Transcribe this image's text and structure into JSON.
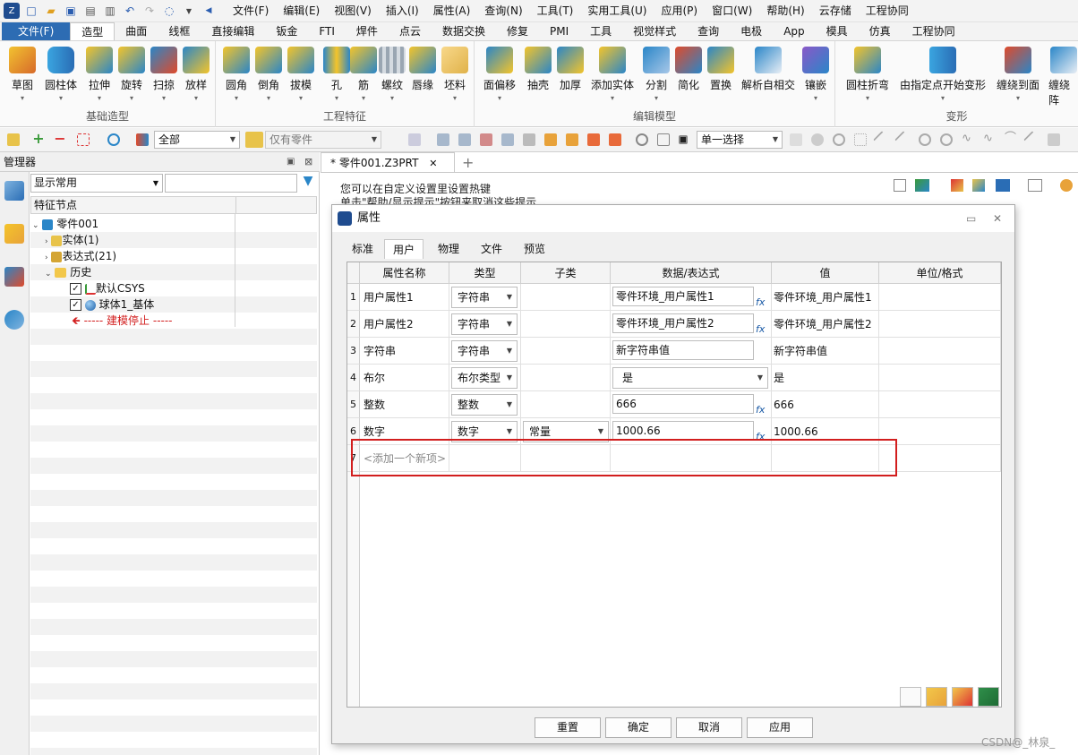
{
  "titlebar": {
    "menus": [
      "文件(F)",
      "编辑(E)",
      "视图(V)",
      "插入(I)",
      "属性(A)",
      "查询(N)",
      "工具(T)",
      "实用工具(U)",
      "应用(P)",
      "窗口(W)",
      "帮助(H)",
      "云存储",
      "工程协同"
    ]
  },
  "ribbon_tabs": [
    "文件(F)",
    "造型",
    "曲面",
    "线框",
    "直接编辑",
    "钣金",
    "FTI",
    "焊件",
    "点云",
    "数据交换",
    "修复",
    "PMI",
    "工具",
    "视觉样式",
    "查询",
    "电极",
    "App",
    "模具",
    "仿真",
    "工程协同"
  ],
  "ribbon": {
    "groups": [
      {
        "title": "基础造型",
        "tools": [
          "草图",
          "圆柱体",
          "拉伸",
          "旋转",
          "扫掠",
          "放样"
        ]
      },
      {
        "title": "工程特征",
        "tools": [
          "圆角",
          "倒角",
          "拔模",
          "孔",
          "筋",
          "螺纹",
          "唇缘",
          "坯料"
        ]
      },
      {
        "title": "编辑模型",
        "tools": [
          "面偏移",
          "抽壳",
          "加厚",
          "添加实体",
          "分割",
          "简化",
          "置换",
          "解析自相交",
          "镶嵌"
        ]
      },
      {
        "title": "变形",
        "tools": [
          "圆柱折弯",
          "由指定点开始变形",
          "缠绕到面",
          "缠绕阵"
        ]
      }
    ]
  },
  "toolbar": {
    "filter_value": "全部",
    "part_filter": "仅有零件",
    "select_mode": "单一选择"
  },
  "manager": {
    "title": "管理器",
    "filter": "显示常用",
    "column": "特征节点",
    "tree": {
      "root": "零件001",
      "solid": "实体(1)",
      "expr": "表达式(21)",
      "history": "历史",
      "csys": "默认CSYS",
      "sphere": "球体1_基体",
      "stop": "----- 建模停止 -----"
    }
  },
  "doc": {
    "tab": "* 零件001.Z3PRT",
    "hint1": "您可以在自定义设置里设置热键",
    "hint2": "单击\"帮助/显示提示\"按钮来取消这些提示"
  },
  "dialog": {
    "title": "属性",
    "tabs": [
      "标准",
      "用户",
      "物理",
      "文件",
      "预览"
    ],
    "headers": [
      "属性名称",
      "类型",
      "子类",
      "数据/表达式",
      "值",
      "单位/格式"
    ],
    "rows": [
      {
        "n": "1",
        "name": "用户属性1",
        "type": "字符串",
        "sub": "",
        "data": "零件环境_用户属性1",
        "value": "零件环境_用户属性1"
      },
      {
        "n": "2",
        "name": "用户属性2",
        "type": "字符串",
        "sub": "",
        "data": "零件环境_用户属性2",
        "value": "零件环境_用户属性2"
      },
      {
        "n": "3",
        "name": "字符串",
        "type": "字符串",
        "sub": "",
        "data": "新字符串值",
        "value": "新字符串值"
      },
      {
        "n": "4",
        "name": "布尔",
        "type": "布尔类型",
        "sub": "",
        "data": "是",
        "value": "是"
      },
      {
        "n": "5",
        "name": "整数",
        "type": "整数",
        "sub": "",
        "data": "666",
        "value": "666"
      },
      {
        "n": "6",
        "name": "数字",
        "type": "数字",
        "sub": "常量",
        "data": "1000.66",
        "value": "1000.66"
      }
    ],
    "new_row": {
      "n": "7",
      "placeholder": "<添加一个新项>"
    },
    "buttons": {
      "reset": "重置",
      "ok": "确定",
      "cancel": "取消",
      "apply": "应用"
    }
  },
  "watermark": "CSDN@_林泉_"
}
